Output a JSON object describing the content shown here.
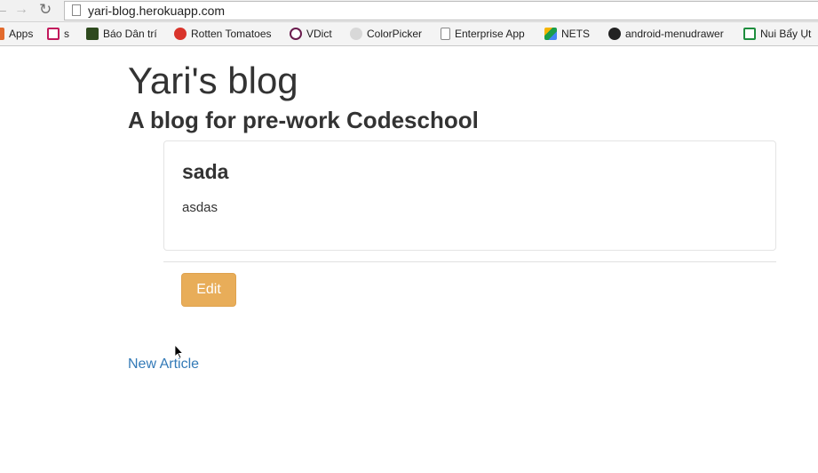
{
  "browser": {
    "url": "yari-blog.herokuapp.com",
    "bookmarks": [
      {
        "label": "Apps",
        "icon": "apps-grid-icon",
        "color": "#e26a2c"
      },
      {
        "label": "s",
        "icon": "e-icon",
        "color": "#c2185b"
      },
      {
        "label": "Báo Dân trí",
        "icon": "d-icon",
        "color": "#2e4a1e"
      },
      {
        "label": "Rotten Tomatoes",
        "icon": "tomato-icon",
        "color": "#d9342b"
      },
      {
        "label": "VDict",
        "icon": "v-icon",
        "color": "#6a1b4d"
      },
      {
        "label": "ColorPicker",
        "icon": "palette-icon",
        "color": "#6b6b6b"
      },
      {
        "label": "Enterprise App",
        "icon": "page-icon",
        "color": "#ffffff"
      },
      {
        "label": "NETS",
        "icon": "drive-icon",
        "color": "#1a9e4a"
      },
      {
        "label": "android-menudrawer",
        "icon": "github-icon",
        "color": "#222222"
      },
      {
        "label": "Nui Bẩy Ụt",
        "icon": "sheets-icon",
        "color": "#1e8e3e"
      }
    ]
  },
  "page": {
    "title": "Yari's blog",
    "subtitle": "A blog for pre-work Codeschool"
  },
  "article": {
    "title": "sada",
    "body": "asdas",
    "edit_label": "Edit"
  },
  "links": {
    "new_article": "New Article"
  },
  "colors": {
    "edit_button": "#e8ad59",
    "link": "#337ab7"
  }
}
